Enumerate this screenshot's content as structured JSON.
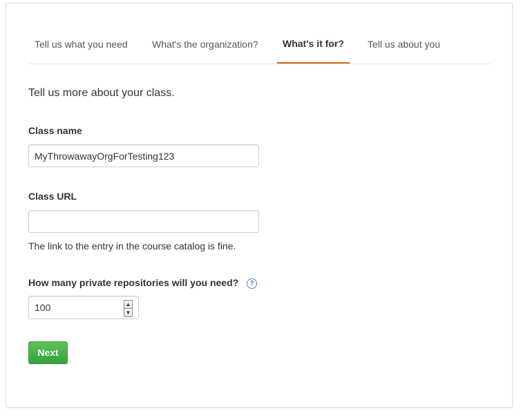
{
  "tabs": [
    {
      "label": "Tell us what you need",
      "active": false
    },
    {
      "label": "What's the organization?",
      "active": false
    },
    {
      "label": "What's it for?",
      "active": true
    },
    {
      "label": "Tell us about you",
      "active": false
    }
  ],
  "intro": "Tell us more about your class.",
  "class_name": {
    "label": "Class name",
    "value": "MyThrowawayOrgForTesting123",
    "placeholder": ""
  },
  "class_url": {
    "label": "Class URL",
    "value": "",
    "placeholder": "",
    "note": "The link to the entry in the course catalog is fine."
  },
  "repos": {
    "label": "How many private repositories will you need?",
    "value": "100",
    "help_icon": "question-circle-icon"
  },
  "next_button": {
    "label": "Next"
  },
  "colors": {
    "accent_tab": "#d26911",
    "primary_button": "#35a13b",
    "help_icon": "#4183c4"
  }
}
